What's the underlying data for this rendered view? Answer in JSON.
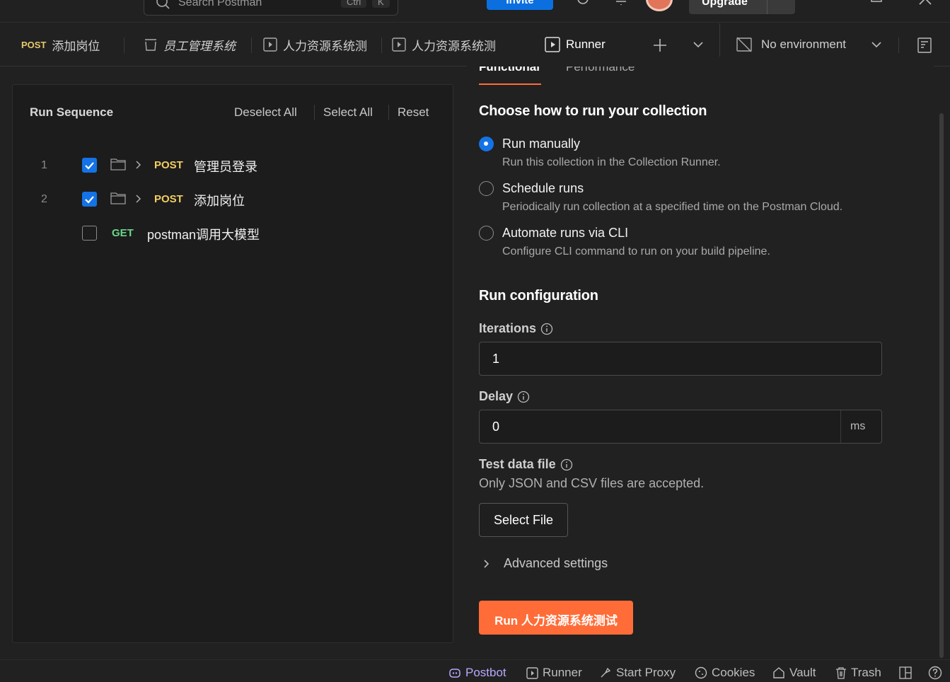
{
  "topbar": {
    "search_placeholder": "Search Postman",
    "search_shortcut_1": "Ctrl",
    "search_shortcut_2": "K",
    "invite_label": "Invite",
    "upgrade_label": "Upgrade"
  },
  "tabs": [
    {
      "method": "POST",
      "label": "添加岗位"
    },
    {
      "label": "员工管理系统"
    },
    {
      "label": "人力资源系统测"
    },
    {
      "label": "人力资源系统测"
    },
    {
      "label": "Runner"
    }
  ],
  "environment": {
    "label": "No environment"
  },
  "run_sequence": {
    "title": "Run Sequence",
    "deselect_all": "Deselect All",
    "select_all": "Select All",
    "reset": "Reset",
    "rows": [
      {
        "num": "1",
        "method": "POST",
        "name": "管理员登录",
        "checked": true
      },
      {
        "num": "2",
        "method": "POST",
        "name": "添加岗位",
        "checked": true
      },
      {
        "num": "",
        "method": "GET",
        "name": "postman调用大模型",
        "checked": false
      }
    ]
  },
  "runner_tabs": {
    "functional": "Functional",
    "performance": "Performance"
  },
  "choose": {
    "heading": "Choose how to run your collection",
    "options": [
      {
        "title": "Run manually",
        "desc": "Run this collection in the Collection Runner.",
        "selected": true
      },
      {
        "title": "Schedule runs",
        "desc": "Periodically run collection at a specified time on the Postman Cloud.",
        "selected": false
      },
      {
        "title": "Automate runs via CLI",
        "desc": "Configure CLI command to run on your build pipeline.",
        "selected": false
      }
    ]
  },
  "config": {
    "heading": "Run configuration",
    "iterations_label": "Iterations",
    "iterations_value": "1",
    "delay_label": "Delay",
    "delay_value": "0",
    "delay_unit": "ms",
    "test_data_label": "Test data file",
    "test_data_note": "Only JSON and CSV files are accepted.",
    "select_file": "Select File",
    "advanced": "Advanced settings",
    "run_button": "Run 人力资源系统测试"
  },
  "statusbar": {
    "postbot": "Postbot",
    "runner": "Runner",
    "start_proxy": "Start Proxy",
    "cookies": "Cookies",
    "vault": "Vault",
    "trash": "Trash"
  },
  "colors": {
    "accent": "#ff6c37",
    "primary": "#1473e6",
    "post": "#f2cf62",
    "get": "#6bd58a"
  }
}
